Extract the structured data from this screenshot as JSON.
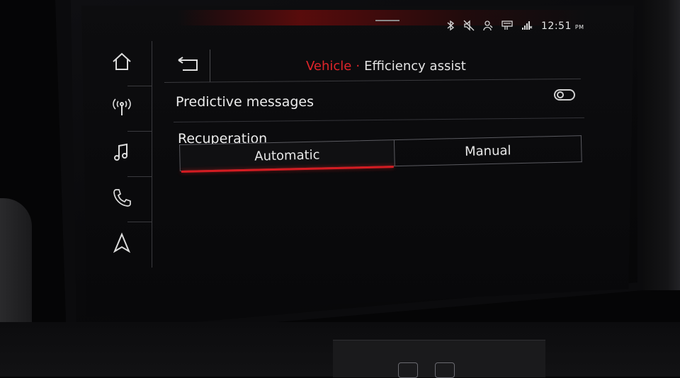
{
  "status_bar": {
    "icons": [
      "bluetooth-icon",
      "mute-icon",
      "user-icon",
      "message-icon",
      "signal-icon"
    ],
    "time": "12:51",
    "ampm": "PM"
  },
  "sidebar": {
    "items": [
      {
        "name": "home-icon"
      },
      {
        "name": "radio-icon"
      },
      {
        "name": "music-icon"
      },
      {
        "name": "phone-icon"
      },
      {
        "name": "navigation-icon"
      }
    ]
  },
  "header": {
    "back_icon": "back-arrow-icon",
    "crumb_parent": "Vehicle",
    "crumb_separator": "·",
    "crumb_current": "Efficiency assist"
  },
  "settings": {
    "predictive_messages_label": "Predictive messages",
    "predictive_messages_enabled": false,
    "recuperation_label": "Recuperation",
    "recuperation_options": [
      "Automatic",
      "Manual"
    ],
    "recuperation_selected": "Automatic"
  },
  "colors": {
    "accent": "#e0252a",
    "text": "#ececec",
    "background": "#0a0a0c"
  }
}
